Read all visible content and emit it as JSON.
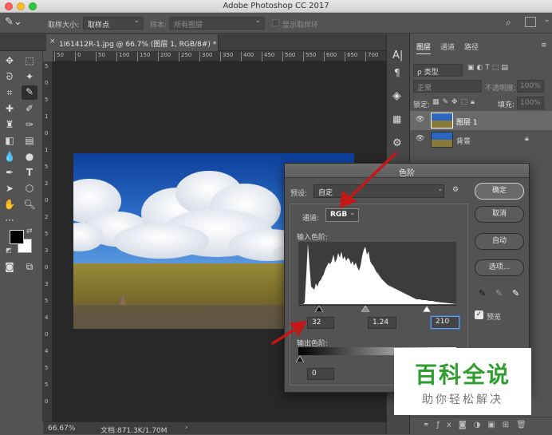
{
  "window": {
    "title": "Adobe Photoshop CC 2017"
  },
  "options_bar": {
    "sample_size_label": "取样大小:",
    "sample_size_value": "取样点",
    "sample_label": "样本:",
    "sample_value": "所有图层",
    "show_ring_label": "显示取样环"
  },
  "document": {
    "tab_title": "1I61412R-1.jpg @ 66.7% (图层 1, RGB/8#) *",
    "ruler_h_ticks": [
      "50",
      "0",
      "50",
      "100",
      "150",
      "200",
      "250",
      "300",
      "350",
      "400",
      "450",
      "500",
      "550",
      "600",
      "650",
      "700"
    ],
    "ruler_v_ticks": [
      "5",
      "0",
      "5",
      "1",
      "0",
      "1",
      "5",
      "2",
      "0",
      "2",
      "5",
      "3",
      "0",
      "3",
      "5",
      "4",
      "0",
      "4",
      "5",
      "5",
      "0"
    ]
  },
  "status": {
    "zoom": "66.67%",
    "doc_size": "文档:871.3K/1.70M"
  },
  "layers_panel": {
    "tabs": [
      "图层",
      "通道",
      "路径"
    ],
    "filter_kind": "ρ 类型",
    "blend_mode": "正常",
    "opacity_label": "不透明度:",
    "opacity_value": "100%",
    "lock_label": "锁定:",
    "fill_label": "填充:",
    "fill_value": "100%",
    "layers": [
      {
        "name": "图层 1"
      },
      {
        "name": "背景"
      }
    ]
  },
  "levels_dialog": {
    "title": "色阶",
    "preset_label": "预设:",
    "preset_value": "自定",
    "channel_label": "通道:",
    "channel_value": "RGB",
    "input_label": "输入色阶:",
    "input_black": "32",
    "input_gamma": "1.24",
    "input_white": "210",
    "output_label": "输出色阶:",
    "output_black": "0",
    "buttons": {
      "ok": "确定",
      "cancel": "取消",
      "auto": "自动",
      "options": "选项..."
    },
    "preview_label": "预览",
    "preview_checked": true
  },
  "watermark": {
    "title": "百科全说",
    "subtitle": "助你轻松解决"
  },
  "colors": {
    "accent_arrow": "#c41717",
    "watermark_green": "#2f9e2f"
  }
}
